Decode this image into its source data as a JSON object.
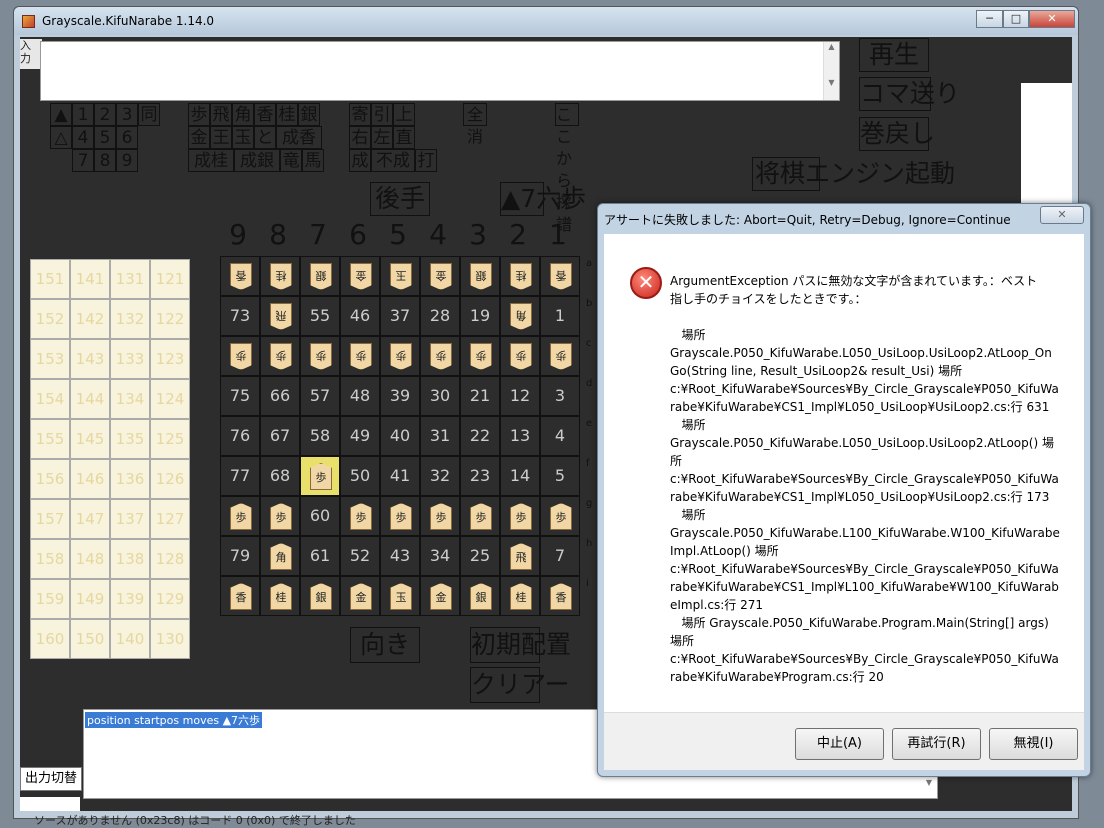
{
  "window": {
    "title": "Grayscale.KifuNarabe 1.14.0",
    "min_label": "─",
    "max_label": "□",
    "close_label": "✕"
  },
  "top_buttons": {
    "play": "再生",
    "step": "コマ送り",
    "rewind": "巻戻し",
    "engine_start": "将棋エンジン起動"
  },
  "side_labels": {
    "nyu": "入",
    "ka": "力"
  },
  "input_row1": [
    "▲",
    "1",
    "2",
    "3",
    "同"
  ],
  "input_row2": [
    "△",
    "4",
    "5",
    "6"
  ],
  "input_row3": [
    "7",
    "8",
    "9"
  ],
  "piece_row1": [
    "歩",
    "飛",
    "角",
    "香",
    "桂",
    "銀"
  ],
  "piece_row2": [
    "金",
    "王",
    "玉",
    "と",
    "成香"
  ],
  "piece_row3": [
    "成桂",
    "成銀",
    "竜",
    "馬"
  ],
  "move_row1": [
    "寄",
    "引",
    "上"
  ],
  "move_row2": [
    "右",
    "左",
    "直"
  ],
  "move_row3": [
    "成",
    "不成",
    "打"
  ],
  "all_clear": "全消",
  "from_here": "ここから採譜",
  "gote_label": "後手",
  "last_move": "▲7六歩",
  "files": [
    "9",
    "8",
    "7",
    "6",
    "5",
    "4",
    "3",
    "2",
    "1"
  ],
  "ranks": [
    "a",
    "b",
    "c",
    "d",
    "e",
    "f",
    "g",
    "h",
    "i"
  ],
  "board": [
    [
      "香",
      "桂",
      "銀",
      "金",
      "玉",
      "金",
      "銀",
      "桂",
      "香"
    ],
    [
      "73",
      "飛",
      "55",
      "46",
      "37",
      "28",
      "19",
      "角",
      "1"
    ],
    [
      "歩",
      "歩",
      "歩",
      "歩",
      "歩",
      "歩",
      "歩",
      "歩",
      "歩"
    ],
    [
      "75",
      "66",
      "57",
      "48",
      "39",
      "30",
      "21",
      "12",
      "3"
    ],
    [
      "76",
      "67",
      "58",
      "49",
      "40",
      "31",
      "22",
      "13",
      "4"
    ],
    [
      "77",
      "68",
      "歩",
      "50",
      "41",
      "32",
      "23",
      "14",
      "5"
    ],
    [
      "歩",
      "歩",
      "60",
      "歩",
      "歩",
      "歩",
      "歩",
      "歩",
      "歩"
    ],
    [
      "79",
      "角",
      "61",
      "52",
      "43",
      "34",
      "25",
      "飛",
      "7"
    ],
    [
      "香",
      "桂",
      "銀",
      "金",
      "玉",
      "金",
      "銀",
      "桂",
      "香"
    ]
  ],
  "hand_rows": [
    [
      "151",
      "141",
      "131",
      "121"
    ],
    [
      "152",
      "142",
      "132",
      "122"
    ],
    [
      "153",
      "143",
      "133",
      "123"
    ],
    [
      "154",
      "144",
      "134",
      "124"
    ],
    [
      "155",
      "145",
      "135",
      "125"
    ],
    [
      "156",
      "146",
      "136",
      "126"
    ],
    [
      "157",
      "147",
      "137",
      "127"
    ],
    [
      "158",
      "148",
      "138",
      "128"
    ],
    [
      "159",
      "149",
      "139",
      "129"
    ],
    [
      "160",
      "150",
      "140",
      "130"
    ]
  ],
  "bottom_buttons": {
    "direction": "向き",
    "initial": "初期配置",
    "clear": "クリアー",
    "output_toggle": "出力切替"
  },
  "output_text": "position startpos moves ▲7六歩",
  "status_text": "ソースがありません (0x23c8) はコード 0 (0x0) で終了しました",
  "dialog": {
    "title": "アサートに失敗しました: Abort=Quit, Retry=Debug, Ignore=Continue",
    "message_lines": [
      "ArgumentException パスに無効な文字が含まれています。：ベスト",
      "指し手のチョイスをしたときです。：",
      "",
      "   場所",
      "Grayscale.P050_KifuWarabe.L050_UsiLoop.UsiLoop2.AtLoop_On",
      "Go(String line, Result_UsiLoop2& result_Usi) 場所",
      "c:¥Root_KifuWarabe¥Sources¥By_Circle_Grayscale¥P050_KifuWa",
      "rabe¥KifuWarabe¥CS1_Impl¥L050_UsiLoop¥UsiLoop2.cs:行 631",
      "   場所",
      "Grayscale.P050_KifuWarabe.L050_UsiLoop.UsiLoop2.AtLoop() 場",
      "所",
      "c:¥Root_KifuWarabe¥Sources¥By_Circle_Grayscale¥P050_KifuWa",
      "rabe¥KifuWarabe¥CS1_Impl¥L050_UsiLoop¥UsiLoop2.cs:行 173",
      "   場所",
      "Grayscale.P050_KifuWarabe.L100_KifuWarabe.W100_KifuWarabe",
      "Impl.AtLoop() 場所",
      "c:¥Root_KifuWarabe¥Sources¥By_Circle_Grayscale¥P050_KifuWa",
      "rabe¥KifuWarabe¥CS1_Impl¥L100_KifuWarabe¥W100_KifuWarab",
      "eImpl.cs:行 271",
      "   場所 Grayscale.P050_KifuWarabe.Program.Main(String[] args)",
      "場所",
      "c:¥Root_KifuWarabe¥Sources¥By_Circle_Grayscale¥P050_KifuWa",
      "rabe¥KifuWarabe¥Program.cs:行 20"
    ],
    "abort": "中止(A)",
    "retry": "再試行(R)",
    "ignore": "無視(I)"
  },
  "colors": {
    "board_bg": "#2d2d2d",
    "piece": "#f1d7a5",
    "hand_bg": "#f7f3dc",
    "error_red": "#d0302a",
    "highlight": "#e8e06a"
  }
}
